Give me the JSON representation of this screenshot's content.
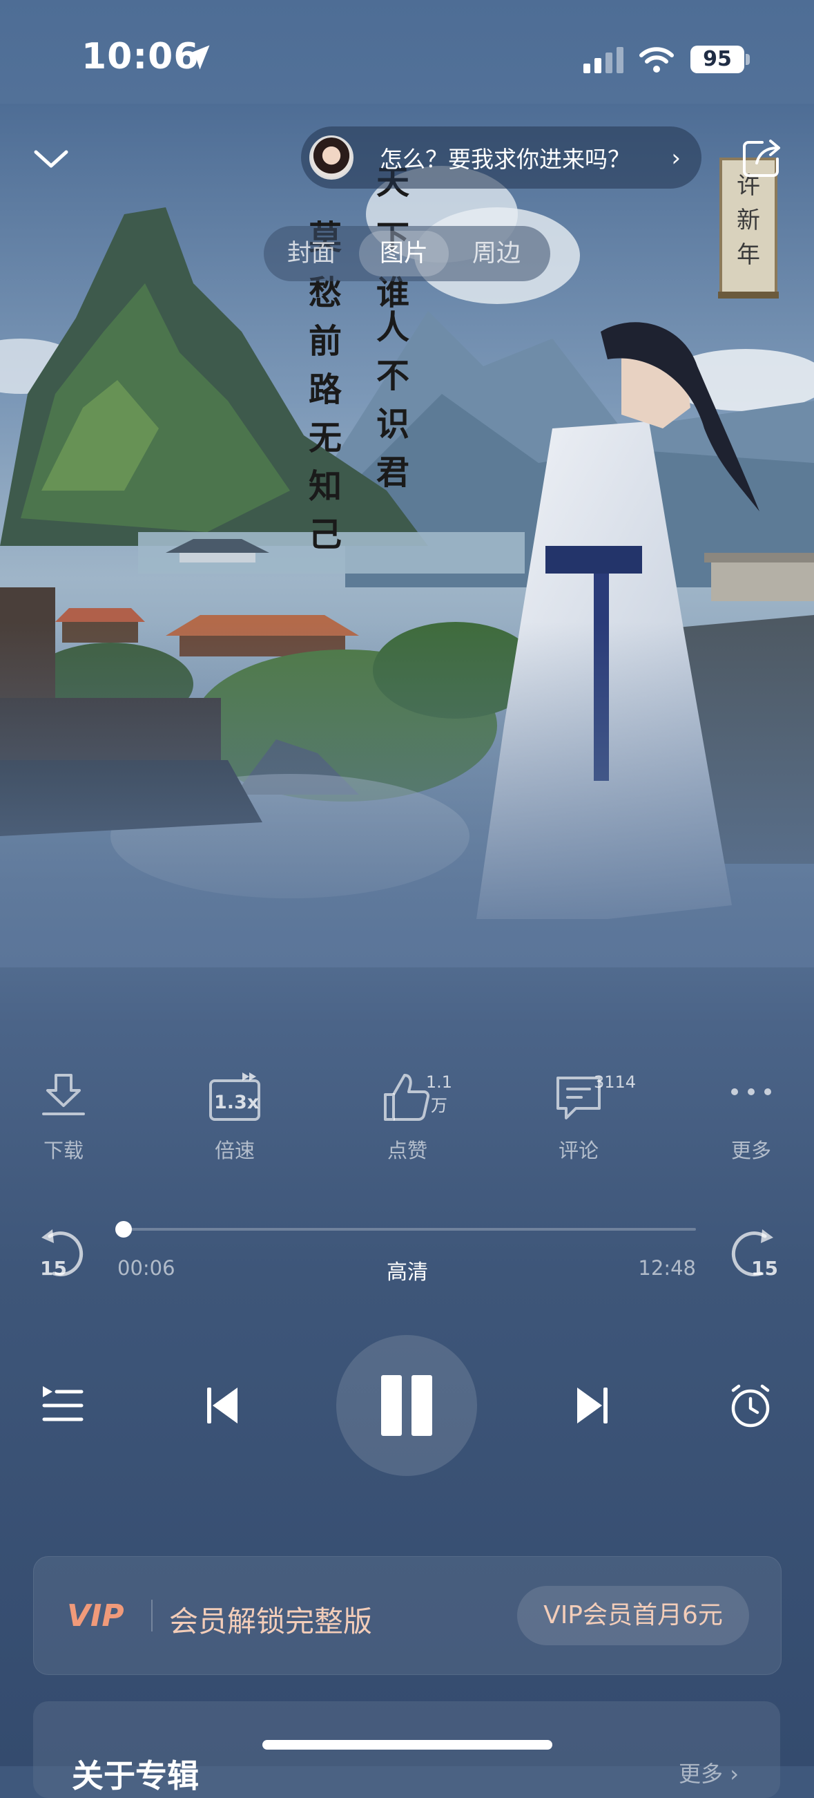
{
  "status_bar": {
    "time": "10:06",
    "battery": "95"
  },
  "header": {
    "chat_prompt": "怎么？要我求你进来吗？",
    "chat_chevron": "›"
  },
  "media_tabs": [
    {
      "label": "封面",
      "active": false
    },
    {
      "label": "图片",
      "active": true
    },
    {
      "label": "周边",
      "active": false
    }
  ],
  "artwork": {
    "scroll_text": "许新年",
    "poem_line_1": "天下谁人不识君",
    "poem_line_2": "莫愁前路无知己"
  },
  "actions": {
    "download": {
      "label": "下载"
    },
    "speed": {
      "label": "倍速",
      "value": "1.3x"
    },
    "like": {
      "label": "点赞",
      "count": "1.1万"
    },
    "comment": {
      "label": "评论",
      "count": "3114"
    },
    "more": {
      "label": "更多"
    }
  },
  "player": {
    "skip_seconds": "15",
    "current_time": "00:06",
    "total_time": "12:48",
    "quality": "高清",
    "progress": 0.008
  },
  "vip": {
    "logo_text": "VIP",
    "text": "会员解锁完整版",
    "button": "VIP会员首月6元"
  },
  "album": {
    "title": "关于专辑",
    "more": "更多 ›"
  },
  "colors": {
    "background": "#3f587c",
    "vip_accent": "#f3cdb9",
    "vip_logo": "#f09a7a"
  }
}
